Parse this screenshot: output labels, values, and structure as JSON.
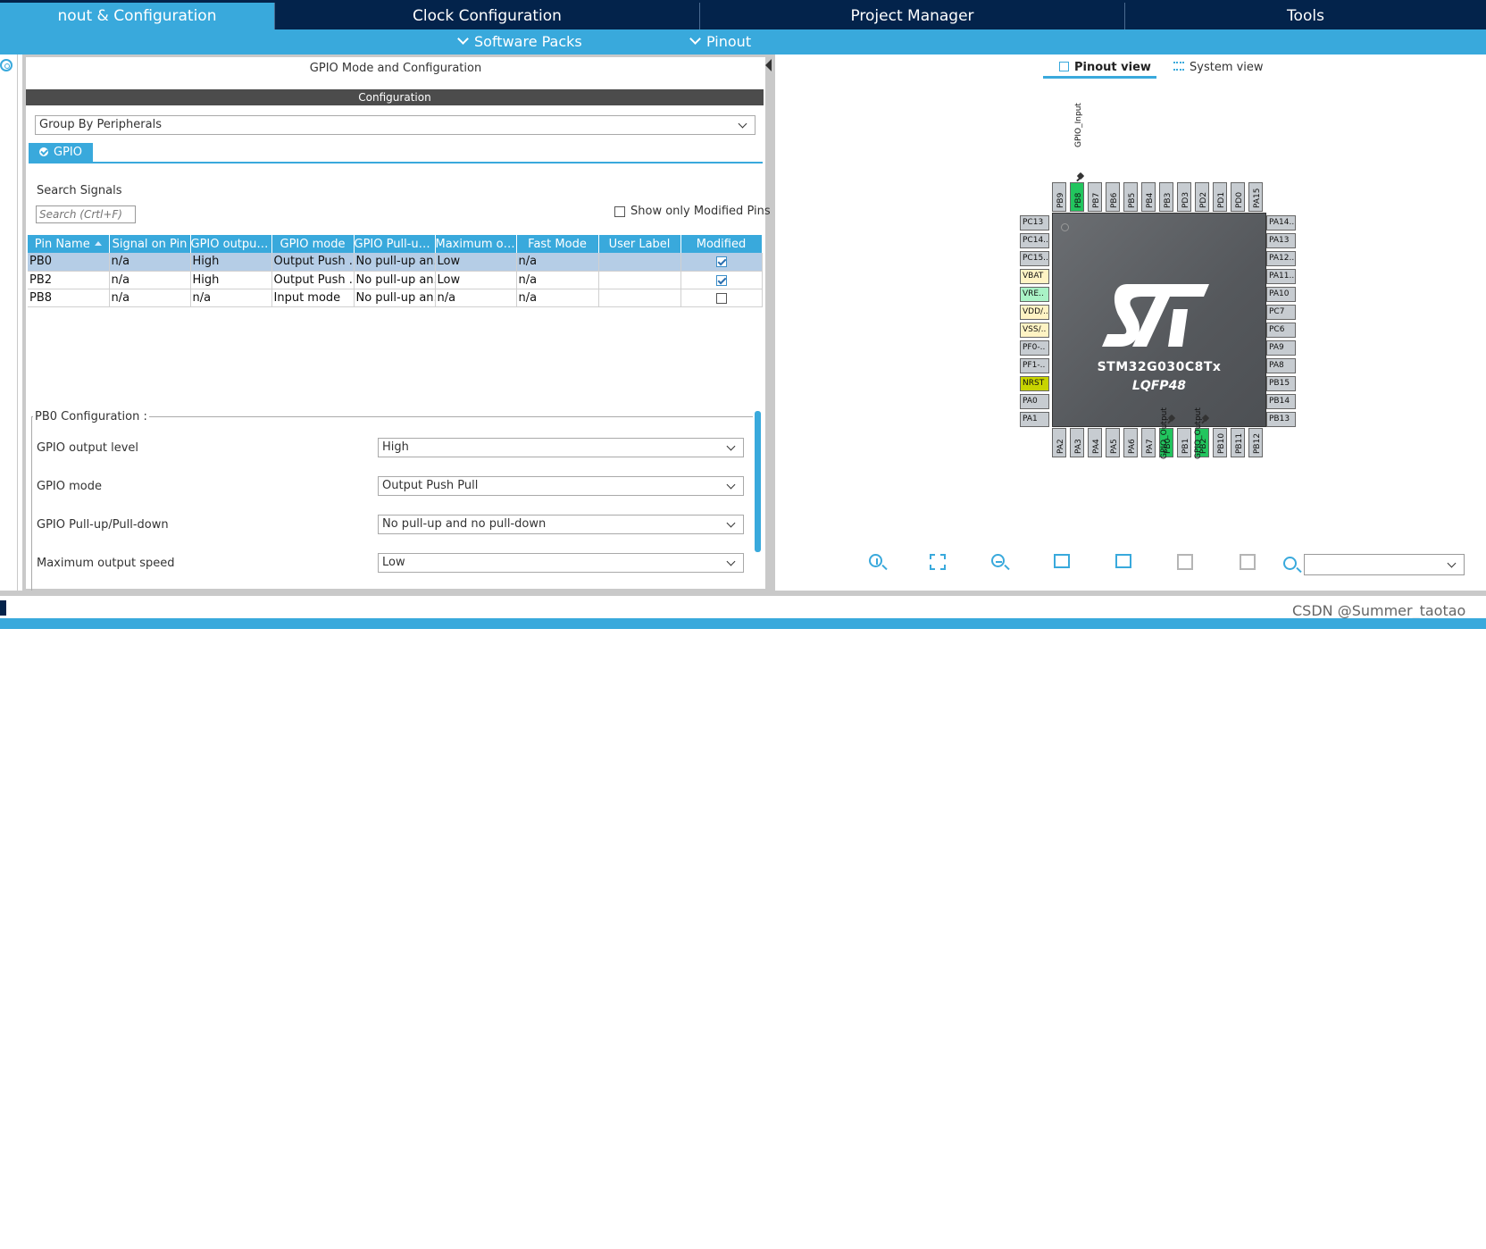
{
  "tabs": [
    {
      "label": "nout & Configuration",
      "active": true
    },
    {
      "label": "Clock Configuration",
      "active": false
    },
    {
      "label": "Project Manager",
      "active": false
    },
    {
      "label": "Tools",
      "active": false
    }
  ],
  "subbar": {
    "software_packs": "Software Packs",
    "pinout": "Pinout"
  },
  "left_panel": {
    "title": "GPIO Mode and Configuration",
    "config_header": "Configuration",
    "group_by": "Group By Peripherals",
    "gpio_tab": "GPIO",
    "search_label": "Search Signals",
    "search_placeholder": "Search (Crtl+F)",
    "show_modified": "Show only Modified Pins",
    "columns": [
      "Pin Name",
      "Signal on Pin",
      "GPIO output ...",
      "GPIO mode",
      "GPIO Pull-up...",
      "Maximum ou...",
      "Fast Mode",
      "User Label",
      "Modified"
    ],
    "rows": [
      {
        "cells": [
          "PB0",
          "n/a",
          "High",
          "Output Push ...",
          "No pull-up an...",
          "Low",
          "n/a",
          ""
        ],
        "modified": true,
        "selected": true
      },
      {
        "cells": [
          "PB2",
          "n/a",
          "High",
          "Output Push ...",
          "No pull-up an...",
          "Low",
          "n/a",
          ""
        ],
        "modified": true,
        "selected": false
      },
      {
        "cells": [
          "PB8",
          "n/a",
          "n/a",
          "Input mode",
          "No pull-up an...",
          "n/a",
          "n/a",
          ""
        ],
        "modified": false,
        "selected": false
      }
    ],
    "pin_config": {
      "legend": "PB0 Configuration :",
      "fields": [
        {
          "label": "GPIO output level",
          "value": "High"
        },
        {
          "label": "GPIO mode",
          "value": "Output Push Pull"
        },
        {
          "label": "GPIO Pull-up/Pull-down",
          "value": "No pull-up and no pull-down"
        },
        {
          "label": "Maximum output speed",
          "value": "Low"
        }
      ]
    }
  },
  "right_panel": {
    "pinout_view": "Pinout view",
    "system_view": "System view",
    "chip_name": "STM32G030C8Tx",
    "package": "LQFP48",
    "top_pins": [
      "PB9",
      "PB8",
      "PB7",
      "PB6",
      "PB5",
      "PB4",
      "PB3",
      "PD3",
      "PD2",
      "PD1",
      "PD0",
      "PA15"
    ],
    "left_pins": [
      "PC13",
      "PC14..",
      "PC15..",
      "VBAT",
      "VRE..",
      "VDD/..",
      "VSS/..",
      "PF0-..",
      "PF1-..",
      "NRST",
      "PA0",
      "PA1"
    ],
    "right_pins": [
      "PA14..",
      "PA13",
      "PA12..",
      "PA11..",
      "PA10",
      "PC7",
      "PC6",
      "PA9",
      "PA8",
      "PB15",
      "PB14",
      "PB13"
    ],
    "bottom_pins": [
      "PA2",
      "PA3",
      "PA4",
      "PA5",
      "PA6",
      "PA7",
      "PB0",
      "PB1",
      "PB2",
      "PB10",
      "PB11",
      "PB12"
    ],
    "signal_top": "GPIO_Input",
    "signal_bottom_1": "GPIO_Output",
    "signal_bottom_2": "GPIO_Output"
  },
  "watermark": "CSDN @Summer_taotao",
  "colors": {
    "accent": "#39a9dc",
    "navy": "#03234b",
    "pin_green": "#22c55e",
    "selected_row": "#b5cde6"
  }
}
